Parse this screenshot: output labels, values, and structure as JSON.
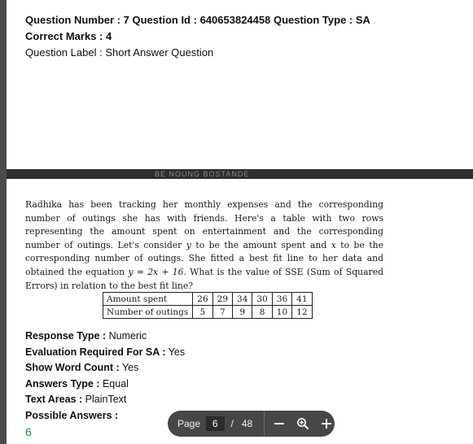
{
  "header": {
    "question_number_label": "Question Number :",
    "question_number": "7",
    "question_id_label": "Question Id :",
    "question_id": "640653824458",
    "question_type_label": "Question Type :",
    "question_type": "SA",
    "correct_marks_label": "Correct Marks :",
    "correct_marks": "4",
    "question_label_label": "Question Label :",
    "question_label": "Short Answer Question"
  },
  "ghost_text": "BE NOUNG BOSTANDE",
  "question": {
    "text_1": "Radhika has been tracking her monthly expenses and the corresponding number of outings she has with friends. Here's a table with two rows representing the amount spent on entertainment and the corresponding number of outings. Let's consider ",
    "var_y": "y",
    "text_2": " to be the amount spent and ",
    "var_x": "x",
    "text_3": " to be the corresponding number of outings. She fitted a best fit line to her data and obtained the equation ",
    "equation": "y = 2x + 16",
    "text_4": ". What is the value of SSE (Sum of Squared Errors) in relation to the best fit line?"
  },
  "table": {
    "row1_header": "Amount spent",
    "row1": [
      "26",
      "29",
      "34",
      "30",
      "36",
      "41"
    ],
    "row2_header": "Number of outings",
    "row2": [
      "5",
      "7",
      "9",
      "8",
      "10",
      "12"
    ]
  },
  "meta": {
    "response_type_label": "Response Type :",
    "response_type": "Numeric",
    "evaluation_label": "Evaluation Required For SA :",
    "evaluation": "Yes",
    "word_count_label": "Show Word Count :",
    "word_count": "Yes",
    "answers_type_label": "Answers Type :",
    "answers_type": "Equal",
    "text_areas_label": "Text Areas :",
    "text_areas": "PlainText",
    "possible_answers_label": "Possible Answers :",
    "possible_answer": "6"
  },
  "toolbar": {
    "page_label": "Page",
    "current_page": "6",
    "separator": "/",
    "total_pages": "48",
    "zoom_out_icon": "minus-icon",
    "zoom_icon": "magnifier-icon",
    "zoom_in_icon": "plus-icon"
  },
  "colors": {
    "answer_green": "#2e8b2e",
    "toolbar_bg": "#474747",
    "viewer_bg": "#3a3a3a"
  }
}
